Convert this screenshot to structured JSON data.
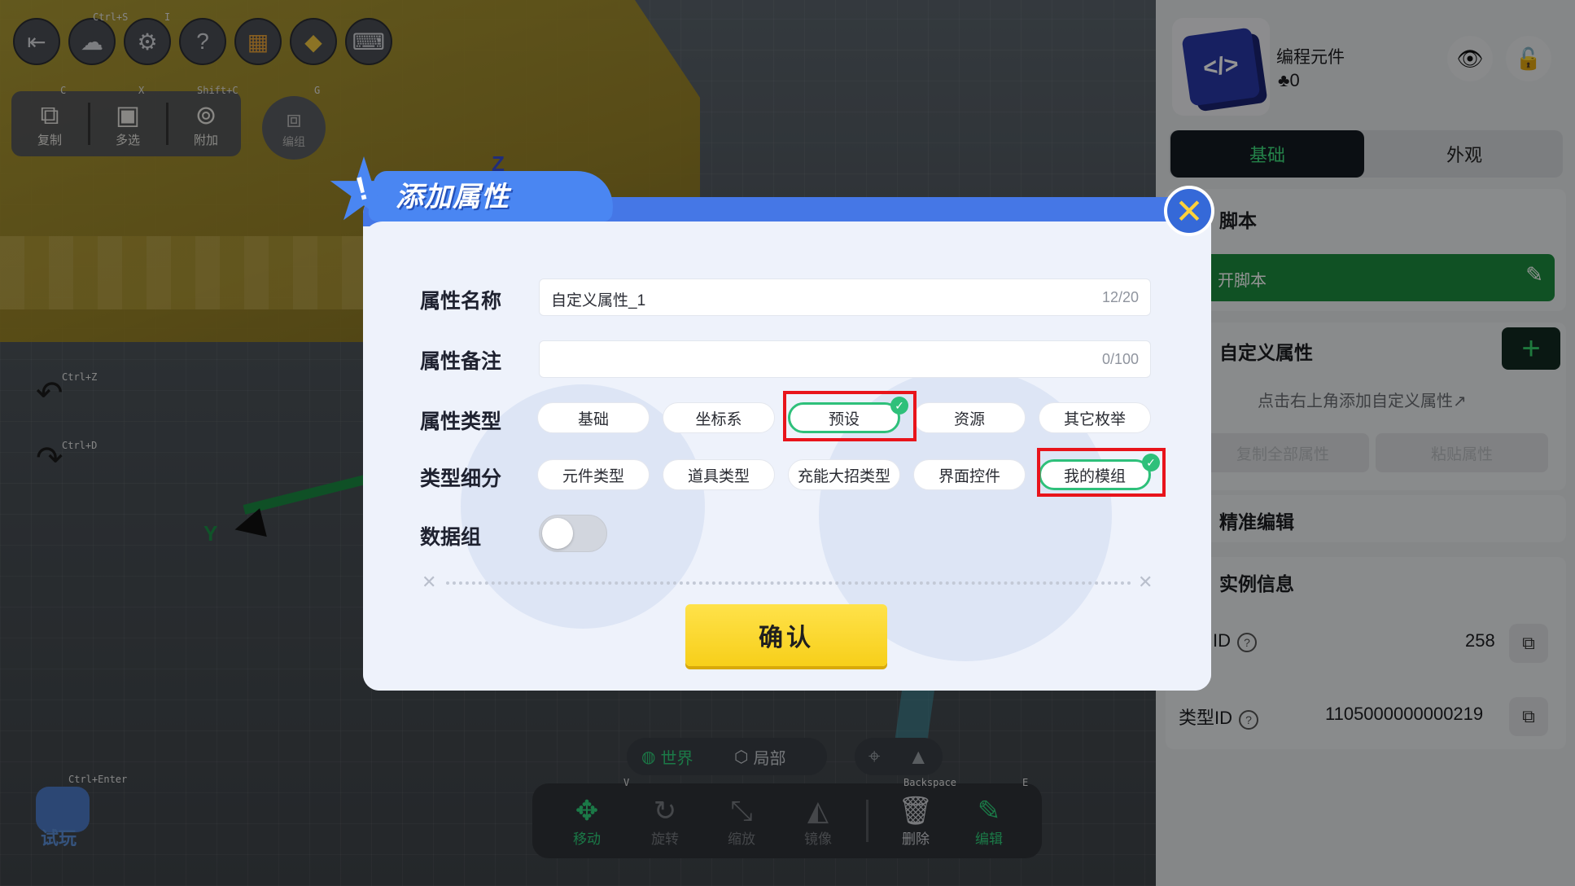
{
  "toolbar": {
    "shortcuts": {
      "save": "Ctrl+S",
      "misc": "I",
      "copy": "C",
      "multi": "X",
      "attach": "Shift+C",
      "group": "G"
    },
    "edit_buttons": {
      "copy": "复制",
      "multi_select": "多选",
      "attach": "附加",
      "group": "编组"
    },
    "undo_shortcut": "Ctrl+Z",
    "redo_shortcut": "Ctrl+D"
  },
  "scene": {
    "axis_z": "Z",
    "axis_y": "Y"
  },
  "dialog": {
    "title": "添加属性",
    "name_label": "属性名称",
    "name_value": "自定义属性_1",
    "name_count": "12/20",
    "note_label": "属性备注",
    "note_value": "",
    "note_count": "0/100",
    "type_label": "属性类型",
    "types": [
      "基础",
      "坐标系",
      "预设",
      "资源",
      "其它枚举"
    ],
    "selected_type": "预设",
    "subtype_label": "类型细分",
    "subtypes": [
      "元件类型",
      "道具类型",
      "充能大招类型",
      "界面控件",
      "我的模组"
    ],
    "selected_subtype": "我的模组",
    "data_group_label": "数据组",
    "data_group_on": false,
    "confirm_label": "确认"
  },
  "panel": {
    "item_title": "编程元件",
    "item_count": "0",
    "tab_basic": "基础",
    "tab_appearance": "外观",
    "script_section": "脚本",
    "open_script": "开脚本",
    "custom_attr_section": "自定义属性",
    "custom_attr_hint": "点击右上角添加自定义属性↗",
    "copy_all": "复制全部属性",
    "paste": "粘贴属性",
    "precise_edit": "精准编辑",
    "instance_info": "实例信息",
    "id_label": "ID",
    "id_value": "258",
    "type_id_label": "类型ID",
    "type_id_value": "1105000000000219"
  },
  "bottom": {
    "world": "世界",
    "local": "局部",
    "move": "移动",
    "rotate": "旋转",
    "scale": "缩放",
    "mirror": "镜像",
    "delete": "删除",
    "edit": "编辑",
    "delete_shortcut": "Backspace",
    "edit_shortcut": "E",
    "move_shortcut": "V",
    "try_shortcut": "Ctrl+Enter",
    "try_label": "试玩"
  },
  "colors": {
    "accent_green": "#2ec07a",
    "highlight_red": "#e8141b",
    "dialog_blue": "#4577e6",
    "confirm_yellow": "#f7cf1a"
  }
}
